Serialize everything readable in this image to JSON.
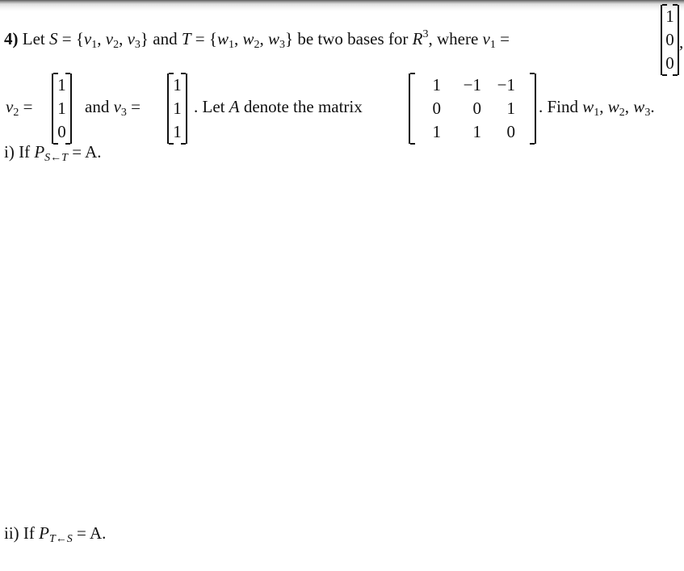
{
  "problem": {
    "number": "4)",
    "intro": {
      "let": "Let",
      "S": "S",
      "eq": "=",
      "S_set": [
        "v",
        "v",
        "v"
      ],
      "S_subs": [
        "1",
        "2",
        "3"
      ],
      "and": "and",
      "T": "T",
      "T_set": [
        "w",
        "w",
        "w"
      ],
      "T_subs": [
        "1",
        "2",
        "3"
      ],
      "be_two_bases": "be two bases for",
      "R": "R",
      "R_exp": "3",
      "where": ", where",
      "v1_label": "v",
      "v1_sub": "1"
    },
    "v1": [
      "1",
      "0",
      "0"
    ],
    "v2_label": "v",
    "v2_sub": "2",
    "v2": [
      "1",
      "1",
      "0"
    ],
    "and_text": "and",
    "v3_label": "v",
    "v3_sub": "3",
    "v3": [
      "1",
      "1",
      "1"
    ],
    "let_a_text": ". Let",
    "A": "A",
    "denote_text": "denote the matrix",
    "matrix_A": [
      [
        "1",
        "−1",
        "−1"
      ],
      [
        "0",
        "0",
        "1"
      ],
      [
        "1",
        "1",
        "0"
      ]
    ],
    "find_text": ". Find",
    "find_vars": "w",
    "find_subs": [
      "1",
      "2",
      "3"
    ]
  },
  "part_i": {
    "label": "i) If",
    "P": "P",
    "sub": "S←T",
    "rest": "= A."
  },
  "part_ii": {
    "label": "ii) If",
    "P": "P",
    "sub": "T←S",
    "rest": "= A."
  }
}
